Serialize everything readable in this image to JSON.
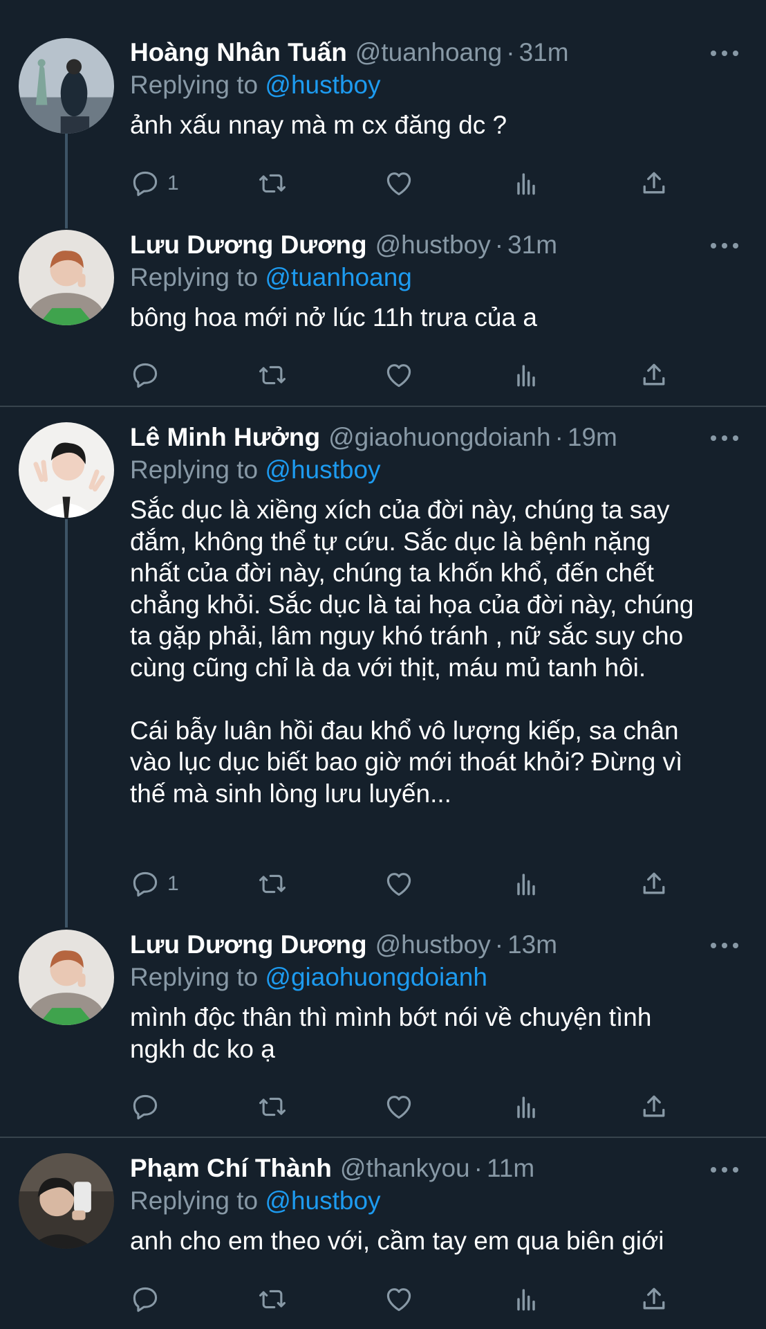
{
  "tweets": [
    {
      "name": "Hoàng Nhân Tuấn",
      "handle": "@tuanhoang",
      "time": "31m",
      "replying_prefix": "Replying to",
      "replying_to": "@hustboy",
      "text": "ảnh xấu nnay mà m cx đăng dc ?",
      "reply_count": "1",
      "avatar": "statue-of-liberty-selfie"
    },
    {
      "name": "Lưu Dương Dương",
      "handle": "@hustboy",
      "time": "31m",
      "replying_prefix": "Replying to",
      "replying_to": "@tuanhoang",
      "text": "bông hoa mới nở lúc 11h trưa của a",
      "reply_count": "",
      "avatar": "person-peace-sign"
    },
    {
      "name": "Lê Minh Hưởng",
      "handle": "@giaohuongdoianh",
      "time": "19m",
      "replying_prefix": "Replying to",
      "replying_to": "@hustboy",
      "text": "Sắc dục là xiềng xích của đời này, chúng ta say\nđắm, không thể tự cứu. Sắc dục là bệnh nặng\nnhất của đời này, chúng ta khốn khổ, đến chết\nchẳng khỏi. Sắc dục là tai họa của đời này, chúng\nta gặp phải, lâm nguy khó tránh , nữ sắc suy cho\ncùng cũng chỉ là da với thịt, máu mủ tanh hôi.\n\nCái bẫy luân hồi đau khổ vô lượng kiếp, sa chân\nvào lục dục biết bao giờ mới thoát khỏi? Đừng vì\nthế mà sinh lòng lưu luyến...",
      "reply_count": "1",
      "avatar": "person-v-sign"
    },
    {
      "name": "Lưu Dương Dương",
      "handle": "@hustboy",
      "time": "13m",
      "replying_prefix": "Replying to",
      "replying_to": "@giaohuongdoianh",
      "text": "mình độc thân thì mình bớt nói về chuyện tình\nngkh dc ko ạ",
      "reply_count": "",
      "avatar": "person-peace-sign"
    },
    {
      "name": "Phạm Chí Thành",
      "handle": "@thankyou",
      "time": "11m",
      "replying_prefix": "Replying to",
      "replying_to": "@hustboy",
      "text": "anh cho em theo với, cầm tay em qua biên giới",
      "reply_count": "",
      "avatar": "mirror-selfie"
    }
  ],
  "icons": {
    "reply": "reply-icon",
    "retweet": "retweet-icon",
    "like": "heart-icon",
    "views": "views-icon",
    "share": "share-icon",
    "more": "more-icon"
  },
  "colors": {
    "background": "#15202b",
    "text": "#ffffff",
    "secondary": "#8899a6",
    "link": "#1d9bf0",
    "divider": "#38444d",
    "thread_line": "#3d5466"
  }
}
